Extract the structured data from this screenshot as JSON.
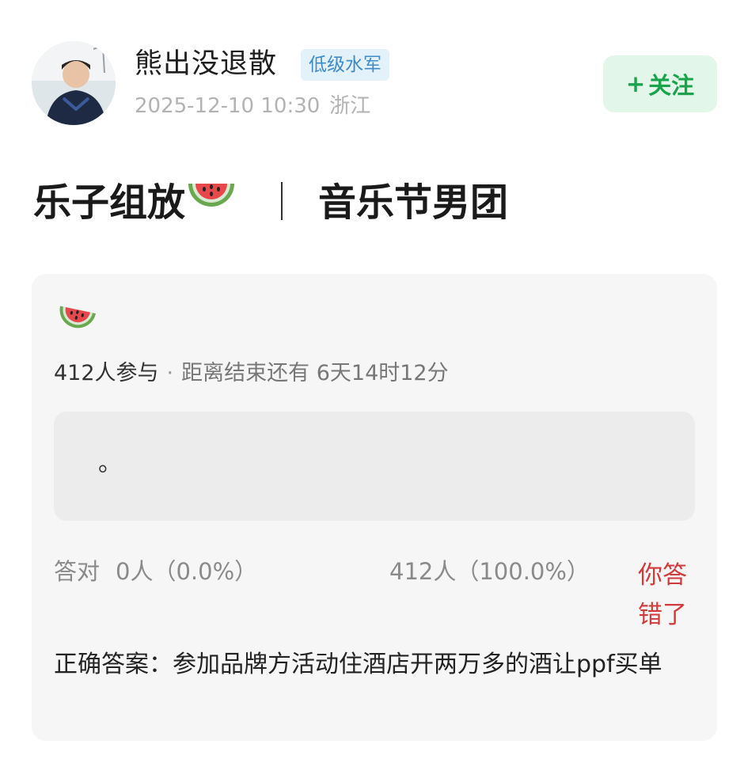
{
  "author": {
    "name": "熊出没退散",
    "badge": "低级水军",
    "timestamp": "2025-12-10 10:30",
    "location": "浙江"
  },
  "follow": {
    "plus": "+",
    "label": "关注",
    "accent": "#19a34a"
  },
  "post": {
    "title_part1": "乐子组放",
    "title_emoji": "watermelon-icon",
    "title_sep": "｜",
    "title_part2": "音乐节男团"
  },
  "quiz": {
    "emoji": "watermelon-icon",
    "participants": "412人参与",
    "dot": "·",
    "remaining": "距离结束还有 6天14时12分",
    "option_text": "。",
    "correct_label": "答对",
    "correct_count": "0人（0.0%）",
    "other_count": "412人（100.0%）",
    "wrong_label": "你答错了",
    "wrong_color": "#d13b3b",
    "answer_text": "正确答案：参加品牌方活动住酒店开两万多的酒让ppf买单"
  }
}
